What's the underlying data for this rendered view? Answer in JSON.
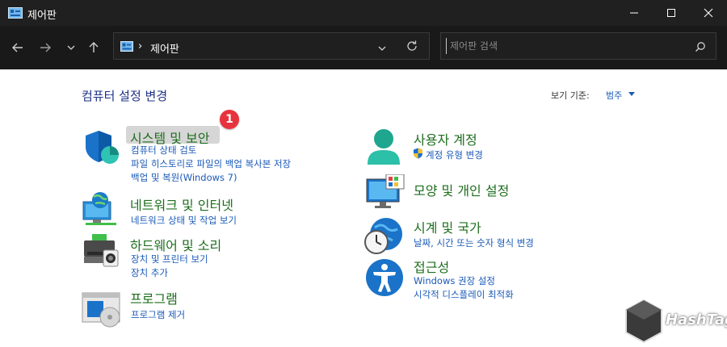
{
  "window": {
    "title": "제어판"
  },
  "address": {
    "separator": "›",
    "path": "제어판"
  },
  "search": {
    "placeholder": "제어판 검색"
  },
  "main": {
    "heading": "컴퓨터 설정 변경",
    "view_by_label": "보기 기준:",
    "view_by_value": "범주",
    "badge": "1",
    "categories_left": [
      {
        "title": "시스템 및 보안",
        "links": [
          "컴퓨터 상태 검토",
          "파일 히스토리로 파일의 백업 복사본 저장",
          "백업 및 복원(Windows 7)"
        ]
      },
      {
        "title": "네트워크 및 인터넷",
        "links": [
          "네트워크 상태 및 작업 보기"
        ]
      },
      {
        "title": "하드웨어 및 소리",
        "links": [
          "장치 및 프린터 보기",
          "장치 추가"
        ]
      },
      {
        "title": "프로그램",
        "links": [
          "프로그램 제거"
        ]
      }
    ],
    "categories_right": [
      {
        "title": "사용자 계정",
        "links": [
          "계정 유형 변경"
        ]
      },
      {
        "title": "모양 및 개인 설정",
        "links": []
      },
      {
        "title": "시계 및 국가",
        "links": [
          "날짜, 시간 또는 숫자 형식 변경"
        ]
      },
      {
        "title": "접근성",
        "links": [
          "Windows 권장 설정",
          "시각적 디스플레이 최적화"
        ]
      }
    ]
  },
  "watermark": {
    "text": "HashTag"
  },
  "colors": {
    "title_bar": "#202020",
    "nav_bar": "#191919",
    "category_title": "#1e6e1e",
    "link": "#1a5ab8",
    "heading": "#1e3287",
    "badge": "#e8333d"
  }
}
